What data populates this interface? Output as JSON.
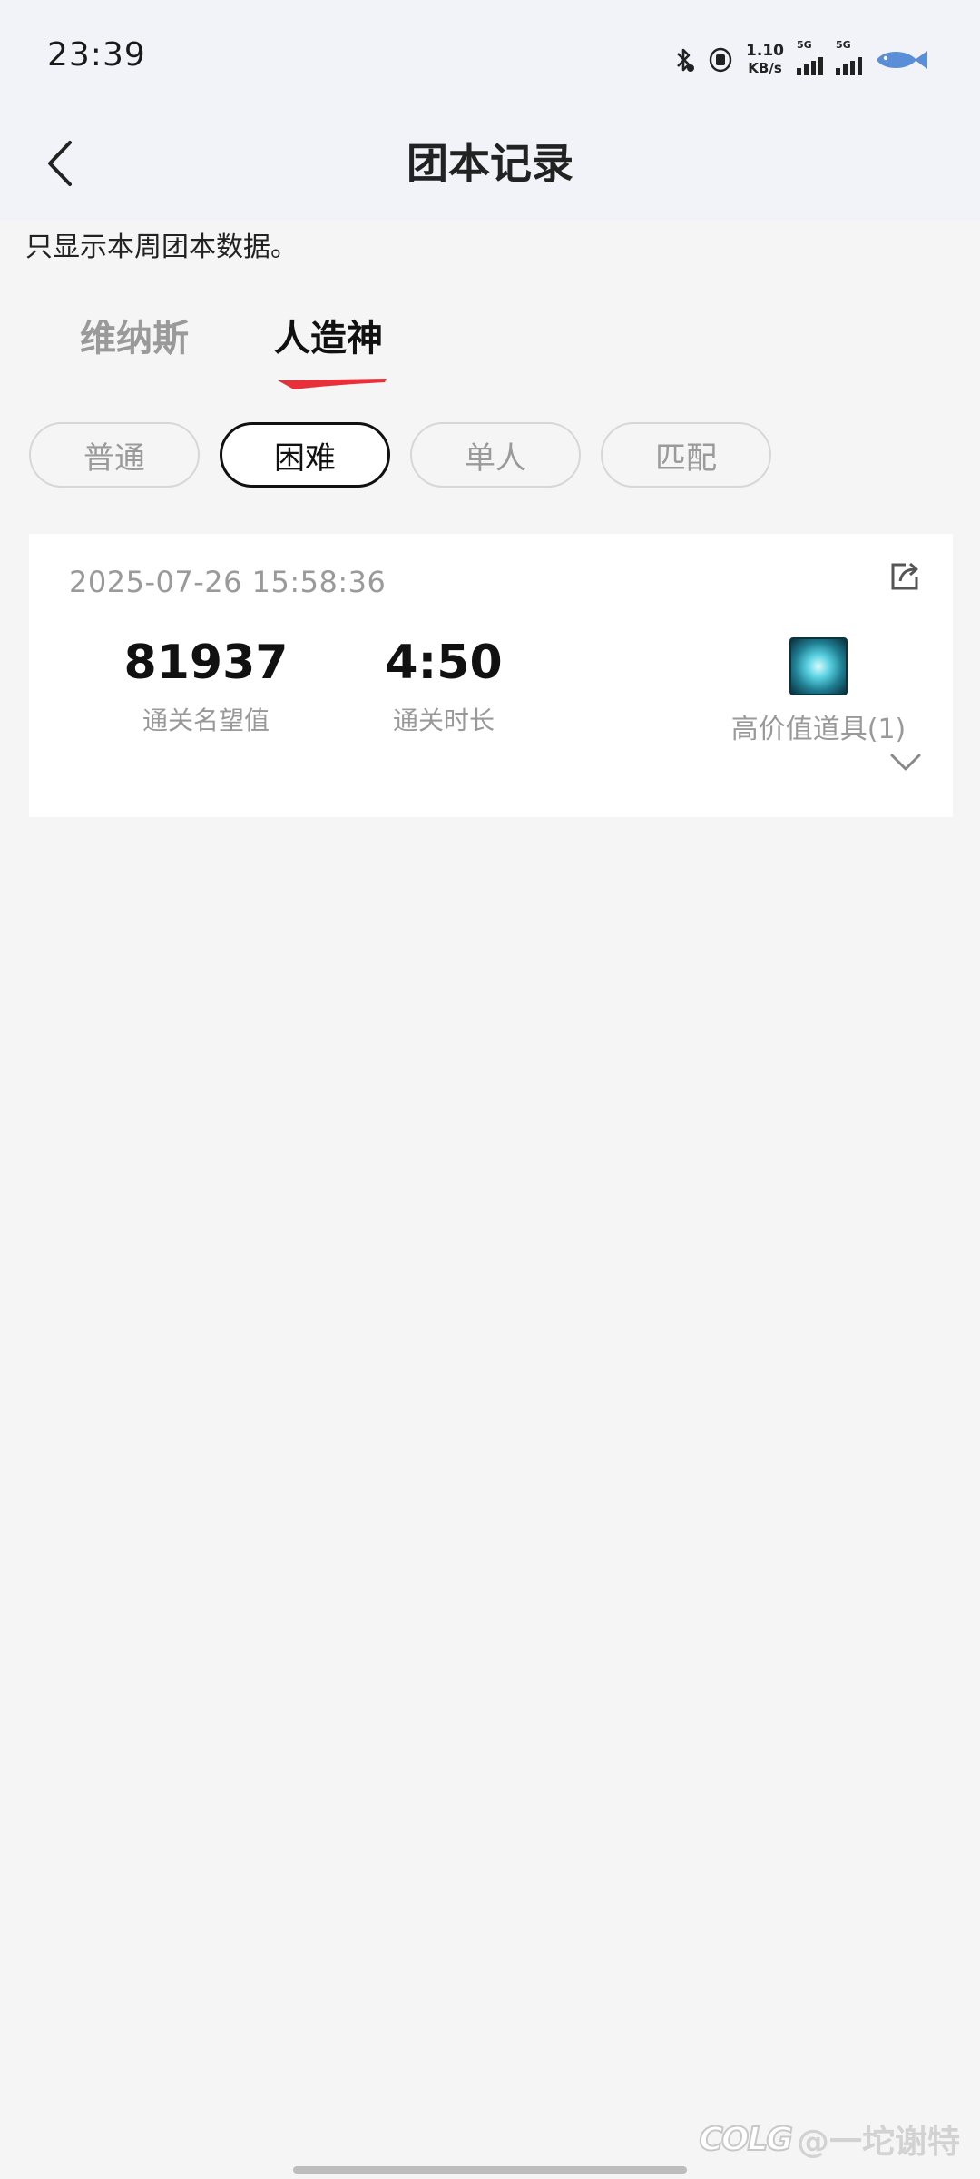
{
  "status_bar": {
    "time": "23:39",
    "net_speed_value": "1.10",
    "net_speed_unit": "KB/s",
    "sim1_label": "5G",
    "sim2_label": "5G",
    "icons": [
      "bluetooth-icon",
      "vpn-icon",
      "signal-icon",
      "signal-icon",
      "battery-fish-icon"
    ]
  },
  "nav": {
    "back_icon": "chevron-left-icon",
    "title": "团本记录"
  },
  "notice": "只显示本周团本数据。",
  "raid_tabs": [
    {
      "label": "维纳斯",
      "active": false
    },
    {
      "label": "人造神",
      "active": true
    }
  ],
  "difficulty_filters": [
    {
      "label": "普通",
      "active": false
    },
    {
      "label": "困难",
      "active": true
    },
    {
      "label": "单人",
      "active": false
    },
    {
      "label": "匹配",
      "active": false
    }
  ],
  "record": {
    "datetime": "2025-07-26 15:58:36",
    "share_icon": "share-icon",
    "reputation_value": "81937",
    "reputation_label": "通关名望值",
    "duration_value": "4:50",
    "duration_label": "通关时长",
    "item_label": "高价值道具(1)",
    "expand_icon": "chevron-down-icon"
  },
  "watermark": {
    "logo": "COLG",
    "handle": "@一坨谢特"
  },
  "colors": {
    "accent_red": "#e8303a",
    "header_bg": "#f1f3f8",
    "page_bg": "#f5f5f5"
  }
}
